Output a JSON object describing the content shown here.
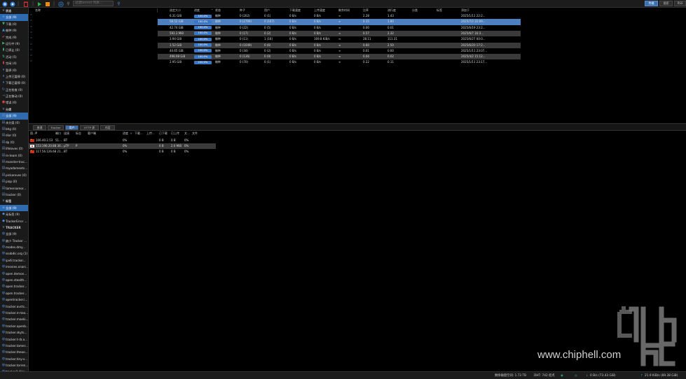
{
  "toolbar": {
    "search_placeholder": "过滤torrent 列表...",
    "right_tabs": [
      "传输",
      "搜索",
      "RSS"
    ]
  },
  "sidebar": {
    "status_header": "状态",
    "status_items": [
      {
        "label": "全部 (9)",
        "icon": "all-icon",
        "color": "#4a90e2"
      },
      {
        "label": "下载 (0)",
        "icon": "download-icon",
        "color": "#3cb371"
      },
      {
        "label": "做种 (9)",
        "icon": "seed-icon",
        "color": "#4a90e2"
      },
      {
        "label": "完成 (9)",
        "icon": "check-icon",
        "color": "#e05080"
      },
      {
        "label": "运行中 (9)",
        "icon": "play-icon",
        "color": "#3cb371"
      },
      {
        "label": "已停止 (0)",
        "icon": "stop-icon",
        "color": "#3cb371"
      },
      {
        "label": "活动 (5)",
        "icon": "activity-icon",
        "color": "#3cb371"
      },
      {
        "label": "空闲 (4)",
        "icon": "idle-icon",
        "color": "#d04040"
      },
      {
        "label": "暂停 (0)",
        "icon": "pause-icon",
        "color": "#4a90e2"
      },
      {
        "label": "上传已暂停 (0)",
        "icon": "upload-paused-icon",
        "color": "#4a90e2"
      },
      {
        "label": "下载已暂停 (0)",
        "icon": "download-paused-icon",
        "color": "#4a90e2"
      },
      {
        "label": "正在检查 (0)",
        "icon": "checking-icon",
        "color": "#4a90e2"
      },
      {
        "label": "正在移动 (0)",
        "icon": "moving-icon",
        "color": "#4a90e2"
      },
      {
        "label": "错误 (0)",
        "icon": "error-icon",
        "color": "#d04040"
      }
    ],
    "category_header": "分类",
    "category_items": [
      "全部 (9)",
      "未分类 (0)",
      "bhg (0)",
      "dior (0)",
      "dp (0)",
      "lifeloves (0)",
      "m-team (0)",
      "monster-trac...",
      "myadamexts...",
      "pickaroves (0)",
      "piop (0)",
      "tamersamor...",
      "tracker (0)"
    ],
    "tag_header": "标签",
    "tag_items": [
      "全部 (9)",
      "无标签 (9)",
      "TrackerError ..."
    ],
    "tracker_header": "TRACKER",
    "tracker_items": [
      "全部 (9)",
      "缺少 Tracker ...",
      "modes.dmy...",
      "ssobdic.org (1)",
      "ipv6.tracker...",
      "imovies.xnarc...",
      "open.demon...",
      "open.stealth...",
      "open.tracker...",
      "open.tracker...",
      "opentracker.i...",
      "tracker.avcts...",
      "tracker.m-tea...",
      "tracker.moeki...",
      "tracker.openb...",
      "tracker.skyts...",
      "tracker.t-rb.o...",
      "tracker.tamer...",
      "tracker.theoe...",
      "tracker.tiny-v...",
      "tracker.torren...",
      "tracker2.dler...",
      "uploads.gum..."
    ]
  },
  "torrents": {
    "columns": [
      "名称",
      "选定大小",
      "进度",
      "状态",
      "种子",
      "用户",
      "下载速度",
      "上传速度",
      "剩余时间",
      "比率",
      "流行度",
      "分类",
      "标签",
      "添加于"
    ],
    "rows": [
      {
        "size": "6.31 GiB",
        "progress": 1.0,
        "progress_text": "100.0%",
        "status": "做种",
        "seeds": "0 (202)",
        "peers": "0 (1)",
        "dl": "0 B/s",
        "ul": "0 B/s",
        "eta": "∞",
        "ratio": "2.28",
        "pop": "1.43",
        "added": "2025/1/11 22:2...",
        "style": "normal"
      },
      {
        "size": "58.52 GiB",
        "progress": 1.0,
        "progress_text": "100.0%",
        "status": "做种",
        "seeds": "0 (2799)",
        "peers": "0 (167)",
        "dl": "0 B/s",
        "ul": "0 B/s",
        "eta": "∞",
        "ratio": "0.15",
        "pop": "1.80",
        "added": "2025/7/2 22:09...",
        "style": "selected"
      },
      {
        "size": "42.74 GiB",
        "progress": 1.0,
        "progress_text": "100.0%",
        "status": "做种",
        "seeds": "0 (22)",
        "peers": "0 (5)",
        "dl": "0 B/s",
        "ul": "0 B/s",
        "eta": "∞",
        "ratio": "0.00",
        "pop": "0.01",
        "added": "2025/6/19 23:2...",
        "style": "normal"
      },
      {
        "size": "592.3 MiB",
        "progress": 1.0,
        "progress_text": "100.0%",
        "status": "做种",
        "seeds": "0 (17)",
        "peers": "0 (2)",
        "dl": "0 B/s",
        "ul": "0 B/s",
        "eta": "∞",
        "ratio": "0.57",
        "pop": "2.32",
        "added": "2025/6/7 16:3...",
        "style": "alt"
      },
      {
        "size": "3.94 GiB",
        "progress": 1.0,
        "progress_text": "100.0%",
        "status": "做种",
        "seeds": "0 (11)",
        "peers": "1 (16)",
        "dl": "0 B/s",
        "ul": "169.8 KiB/s",
        "eta": "∞",
        "ratio": "28.11",
        "pop": "111.31",
        "added": "2025/6/27 00:0...",
        "style": "normal"
      },
      {
        "size": "1.52 GiB",
        "progress": 1.0,
        "progress_text": "100.0%",
        "status": "做种",
        "seeds": "0 (1049)",
        "peers": "0 (6)",
        "dl": "0 B/s",
        "ul": "0 B/s",
        "eta": "∞",
        "ratio": "0.60",
        "pop": "2.50",
        "added": "2025/6/20 17:2...",
        "style": "alt"
      },
      {
        "size": "44.65 GiB",
        "progress": 1.0,
        "progress_text": "100.0%",
        "status": "做种",
        "seeds": "0 (34)",
        "peers": "0 (2)",
        "dl": "0 B/s",
        "ul": "0 B/s",
        "eta": "∞",
        "ratio": "0.01",
        "pop": "0.00",
        "added": "2025/1/11 23:07...",
        "style": "normal"
      },
      {
        "size": "498.08 GiB",
        "progress": 1.0,
        "progress_text": "100.0%",
        "status": "做种",
        "seeds": "0 (136)",
        "peers": "0 (9)",
        "dl": "0 B/s",
        "ul": "0 B/s",
        "eta": "∞",
        "ratio": "0.04",
        "pop": "0.02",
        "added": "2025/4/2 15:12...",
        "style": "alt"
      },
      {
        "size": "2.95 GiB",
        "progress": 1.0,
        "progress_text": "100.0%",
        "status": "做种",
        "seeds": "0 (70)",
        "peers": "0 (1)",
        "dl": "0 B/s",
        "ul": "0 B/s",
        "eta": "∞",
        "ratio": "0.22",
        "pop": "0.11",
        "added": "2025/1/11 23:17...",
        "style": "normal"
      }
    ]
  },
  "detail_tabs": [
    "普通",
    "Tracker",
    "用户",
    "HTTP 源",
    "内容"
  ],
  "peers": {
    "columns": [
      "国..IP",
      "端口",
      "连接",
      "标志",
      "客户端",
      "进度",
      "下载...",
      "上传...",
      "已下载",
      "已上传",
      "文...",
      "文件"
    ],
    "rows": [
      {
        "flag": "cn",
        "ip": "106.40.2.53",
        "port": "51...",
        "conn": "BT",
        "flags": "",
        "client": "",
        "progress": "0%",
        "dl": "",
        "ul": "",
        "downloaded": "0 B",
        "uploaded": "0 B",
        "relevance": "0%",
        "selected": false
      },
      {
        "flag": "jp",
        "ip": "153.190.20.88 36...",
        "port": "",
        "conn": "μTP",
        "flags": "P",
        "client": "",
        "progress": "0%",
        "dl": "",
        "ul": "",
        "downloaded": "0 B",
        "uploaded": "2.0 MiB",
        "relevance": "0%",
        "selected": true
      },
      {
        "flag": "cn",
        "ip": "117.56.126.68 21...",
        "port": "",
        "conn": "BT",
        "flags": "",
        "client": "",
        "progress": "0%",
        "dl": "",
        "ul": "",
        "downloaded": "0 B",
        "uploaded": "0 B",
        "relevance": "0%",
        "selected": false
      }
    ]
  },
  "statusbar": {
    "free_space": "剩余磁盘空间: 1.73 TB",
    "dht": "DHT: 742 结点",
    "download": "0 B/s (73.43 GiB)",
    "upload": "21.9 KiB/s (89.38 GiB)"
  },
  "watermark": {
    "url": "www.chiphell.com"
  },
  "colors": {
    "accent": "#3b6fb0",
    "progress": "#3a78c6",
    "row_alt": "#3a3a3a",
    "row_selected": "#4c80c0"
  }
}
